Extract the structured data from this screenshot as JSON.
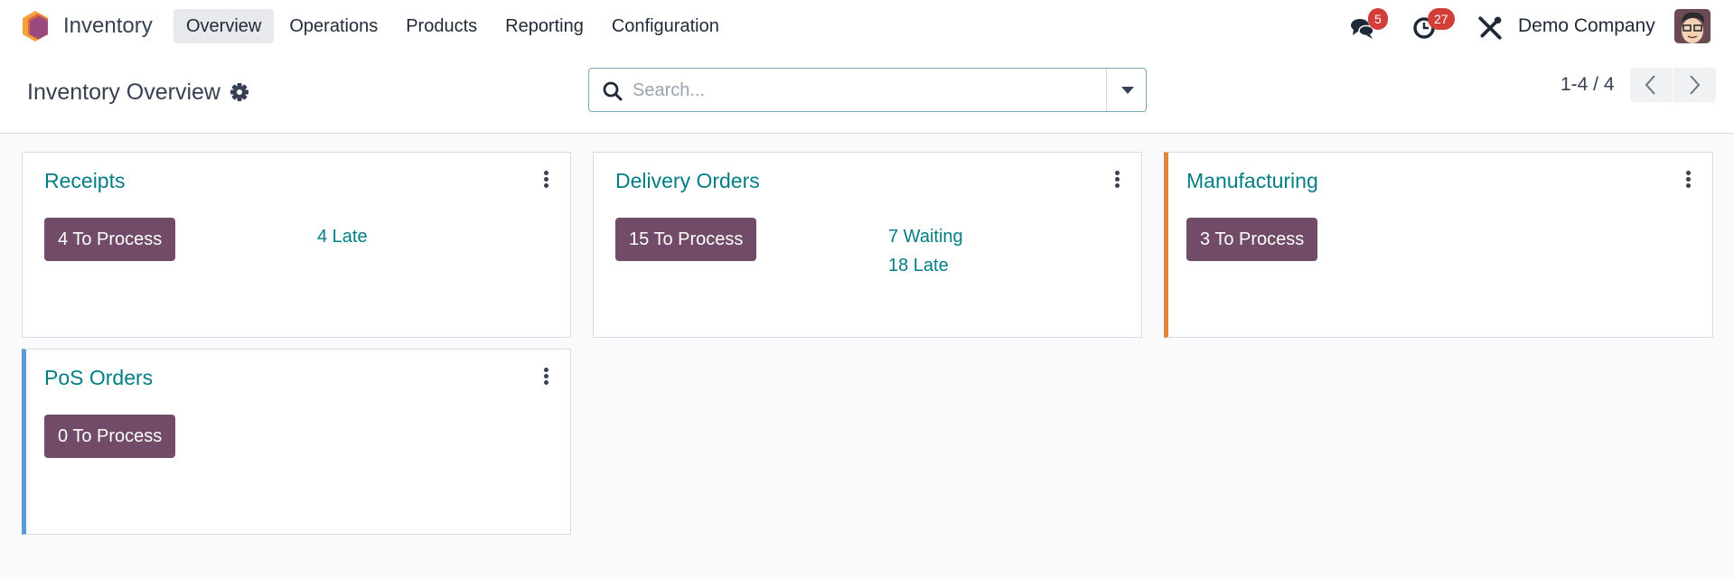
{
  "navbar": {
    "app_name": "Inventory",
    "menu": [
      {
        "label": "Overview",
        "active": true
      },
      {
        "label": "Operations",
        "active": false
      },
      {
        "label": "Products",
        "active": false
      },
      {
        "label": "Reporting",
        "active": false
      },
      {
        "label": "Configuration",
        "active": false
      }
    ],
    "messages_badge": "5",
    "activities_badge": "27",
    "company": "Demo Company",
    "badge_color": "#d23f3a"
  },
  "control_panel": {
    "title": "Inventory Overview",
    "search_placeholder": "Search...",
    "pager": "1-4 / 4"
  },
  "cards": [
    {
      "title": "Receipts",
      "process_label": "4 To Process",
      "stats": [
        "4 Late"
      ],
      "accent": null
    },
    {
      "title": "Delivery Orders",
      "process_label": "15 To Process",
      "stats": [
        "7 Waiting",
        "18 Late"
      ],
      "accent": null
    },
    {
      "title": "Manufacturing",
      "process_label": "3 To Process",
      "stats": [],
      "accent": "#e1853a"
    },
    {
      "title": "PoS Orders",
      "process_label": "0 To Process",
      "stats": [],
      "accent": "#5b99d6"
    }
  ],
  "colors": {
    "primary": "#714b67",
    "link": "#017e84"
  }
}
